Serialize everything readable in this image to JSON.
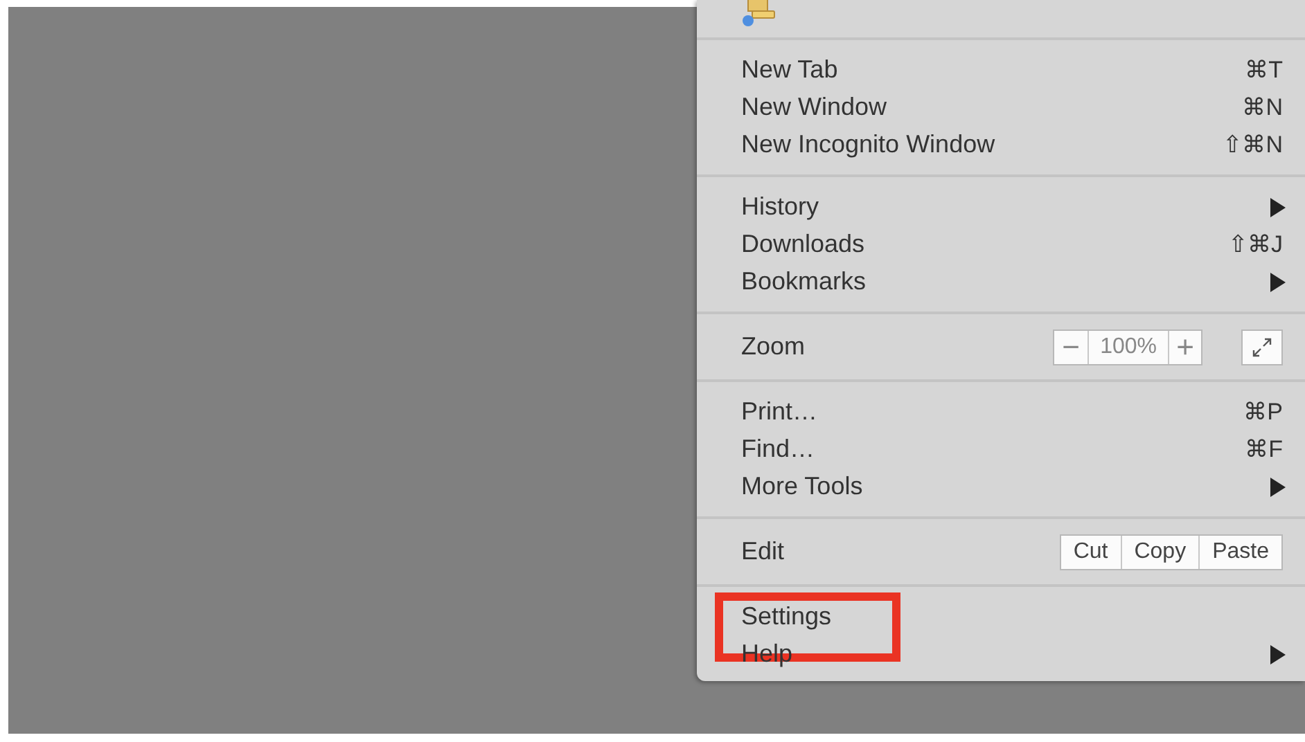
{
  "menu": {
    "sections": [
      {
        "kind": "icons"
      },
      {
        "kind": "items",
        "items": [
          {
            "label": "New Tab",
            "shortcut": "⌘T",
            "submenu": false,
            "highlighted": false
          },
          {
            "label": "New Window",
            "shortcut": "⌘N",
            "submenu": false,
            "highlighted": false
          },
          {
            "label": "New Incognito Window",
            "shortcut": "⇧⌘N",
            "submenu": false,
            "highlighted": false
          }
        ]
      },
      {
        "kind": "items",
        "items": [
          {
            "label": "History",
            "submenu": true,
            "highlighted": false
          },
          {
            "label": "Downloads",
            "shortcut": "⇧⌘J",
            "submenu": false,
            "highlighted": false
          },
          {
            "label": "Bookmarks",
            "submenu": true,
            "highlighted": false
          }
        ]
      },
      {
        "kind": "zoom",
        "label": "Zoom",
        "minus": "−",
        "value": "100%",
        "plus": "+"
      },
      {
        "kind": "items",
        "items": [
          {
            "label": "Print…",
            "shortcut": "⌘P",
            "submenu": false,
            "highlighted": false
          },
          {
            "label": "Find…",
            "shortcut": "⌘F",
            "submenu": false,
            "highlighted": false
          },
          {
            "label": "More Tools",
            "submenu": true,
            "highlighted": false
          }
        ]
      },
      {
        "kind": "edit",
        "label": "Edit",
        "buttons": [
          "Cut",
          "Copy",
          "Paste"
        ]
      },
      {
        "kind": "items",
        "items": [
          {
            "label": "Settings",
            "submenu": false,
            "highlighted": true
          },
          {
            "label": "Help",
            "submenu": true,
            "highlighted": false
          }
        ]
      }
    ]
  }
}
